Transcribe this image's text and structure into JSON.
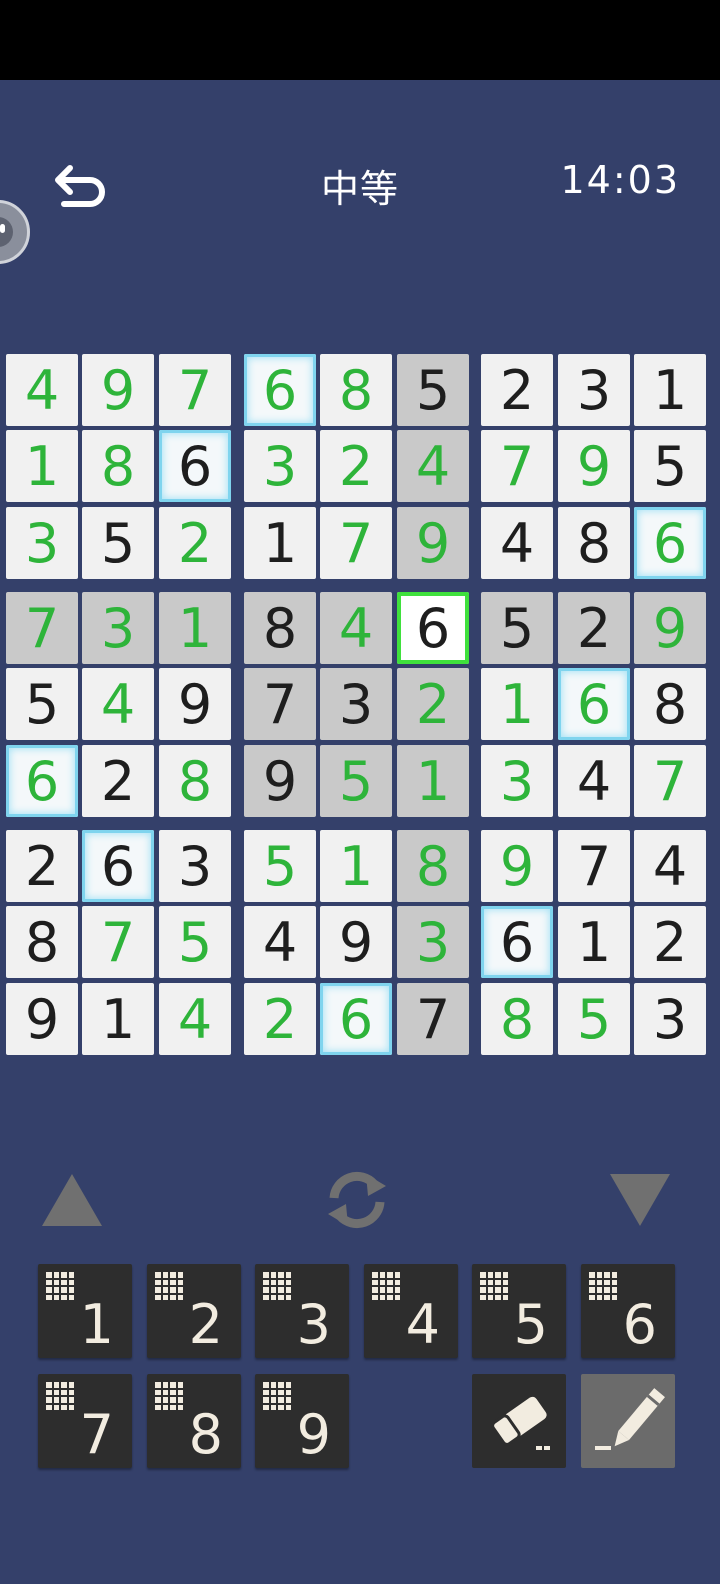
{
  "header": {
    "difficulty": "中等",
    "timer": "14:03"
  },
  "board": {
    "values": [
      [
        "4",
        "9",
        "7",
        "6",
        "8",
        "5",
        "2",
        "3",
        "1"
      ],
      [
        "1",
        "8",
        "6",
        "3",
        "2",
        "4",
        "7",
        "9",
        "5"
      ],
      [
        "3",
        "5",
        "2",
        "1",
        "7",
        "9",
        "4",
        "8",
        "6"
      ],
      [
        "7",
        "3",
        "1",
        "8",
        "4",
        "6",
        "5",
        "2",
        "9"
      ],
      [
        "5",
        "4",
        "9",
        "7",
        "3",
        "2",
        "1",
        "6",
        "8"
      ],
      [
        "6",
        "2",
        "8",
        "9",
        "5",
        "1",
        "3",
        "4",
        "7"
      ],
      [
        "2",
        "6",
        "3",
        "5",
        "1",
        "8",
        "9",
        "7",
        "4"
      ],
      [
        "8",
        "7",
        "5",
        "4",
        "9",
        "3",
        "6",
        "1",
        "2"
      ],
      [
        "9",
        "1",
        "4",
        "2",
        "6",
        "7",
        "8",
        "5",
        "3"
      ]
    ],
    "colors": [
      [
        "g",
        "g",
        "g",
        "g",
        "g",
        "b",
        "b",
        "b",
        "b"
      ],
      [
        "g",
        "g",
        "b",
        "g",
        "g",
        "g",
        "g",
        "g",
        "b"
      ],
      [
        "g",
        "b",
        "g",
        "b",
        "g",
        "g",
        "b",
        "b",
        "g"
      ],
      [
        "g",
        "g",
        "g",
        "b",
        "g",
        "b",
        "b",
        "b",
        "g"
      ],
      [
        "b",
        "g",
        "b",
        "b",
        "b",
        "g",
        "g",
        "g",
        "b"
      ],
      [
        "g",
        "b",
        "g",
        "b",
        "g",
        "g",
        "g",
        "b",
        "g"
      ],
      [
        "b",
        "b",
        "b",
        "g",
        "g",
        "g",
        "g",
        "b",
        "b"
      ],
      [
        "b",
        "g",
        "g",
        "b",
        "b",
        "g",
        "b",
        "b",
        "b"
      ],
      [
        "b",
        "b",
        "g",
        "g",
        "g",
        "b",
        "g",
        "g",
        "b"
      ]
    ],
    "highlight": [
      [
        "",
        "",
        "",
        "blue",
        "",
        "gray",
        "",
        "",
        ""
      ],
      [
        "",
        "",
        "blue",
        "",
        "",
        "gray",
        "",
        "",
        ""
      ],
      [
        "",
        "",
        "",
        "",
        "",
        "gray",
        "",
        "",
        "blue"
      ],
      [
        "gray",
        "gray",
        "gray",
        "gray",
        "gray",
        "selected",
        "gray",
        "gray",
        "gray"
      ],
      [
        "",
        "",
        "",
        "gray",
        "gray",
        "gray",
        "",
        "blue",
        ""
      ],
      [
        "blue",
        "",
        "",
        "gray",
        "gray",
        "gray",
        "",
        "",
        ""
      ],
      [
        "",
        "blue",
        "",
        "",
        "",
        "gray",
        "",
        "",
        ""
      ],
      [
        "",
        "",
        "",
        "",
        "",
        "gray",
        "blue",
        "",
        ""
      ],
      [
        "",
        "",
        "",
        "",
        "blue",
        "gray",
        "",
        "",
        ""
      ]
    ],
    "green_color": "#2eb43a",
    "given_color": "#1e1e1e"
  },
  "keypad": {
    "keys": [
      "1",
      "2",
      "3",
      "4",
      "5",
      "6",
      "7",
      "8",
      "9"
    ]
  },
  "colors": {
    "background": "#34406a",
    "selected_border": "#3fe03c",
    "match_glow": "#7fd4ee"
  }
}
